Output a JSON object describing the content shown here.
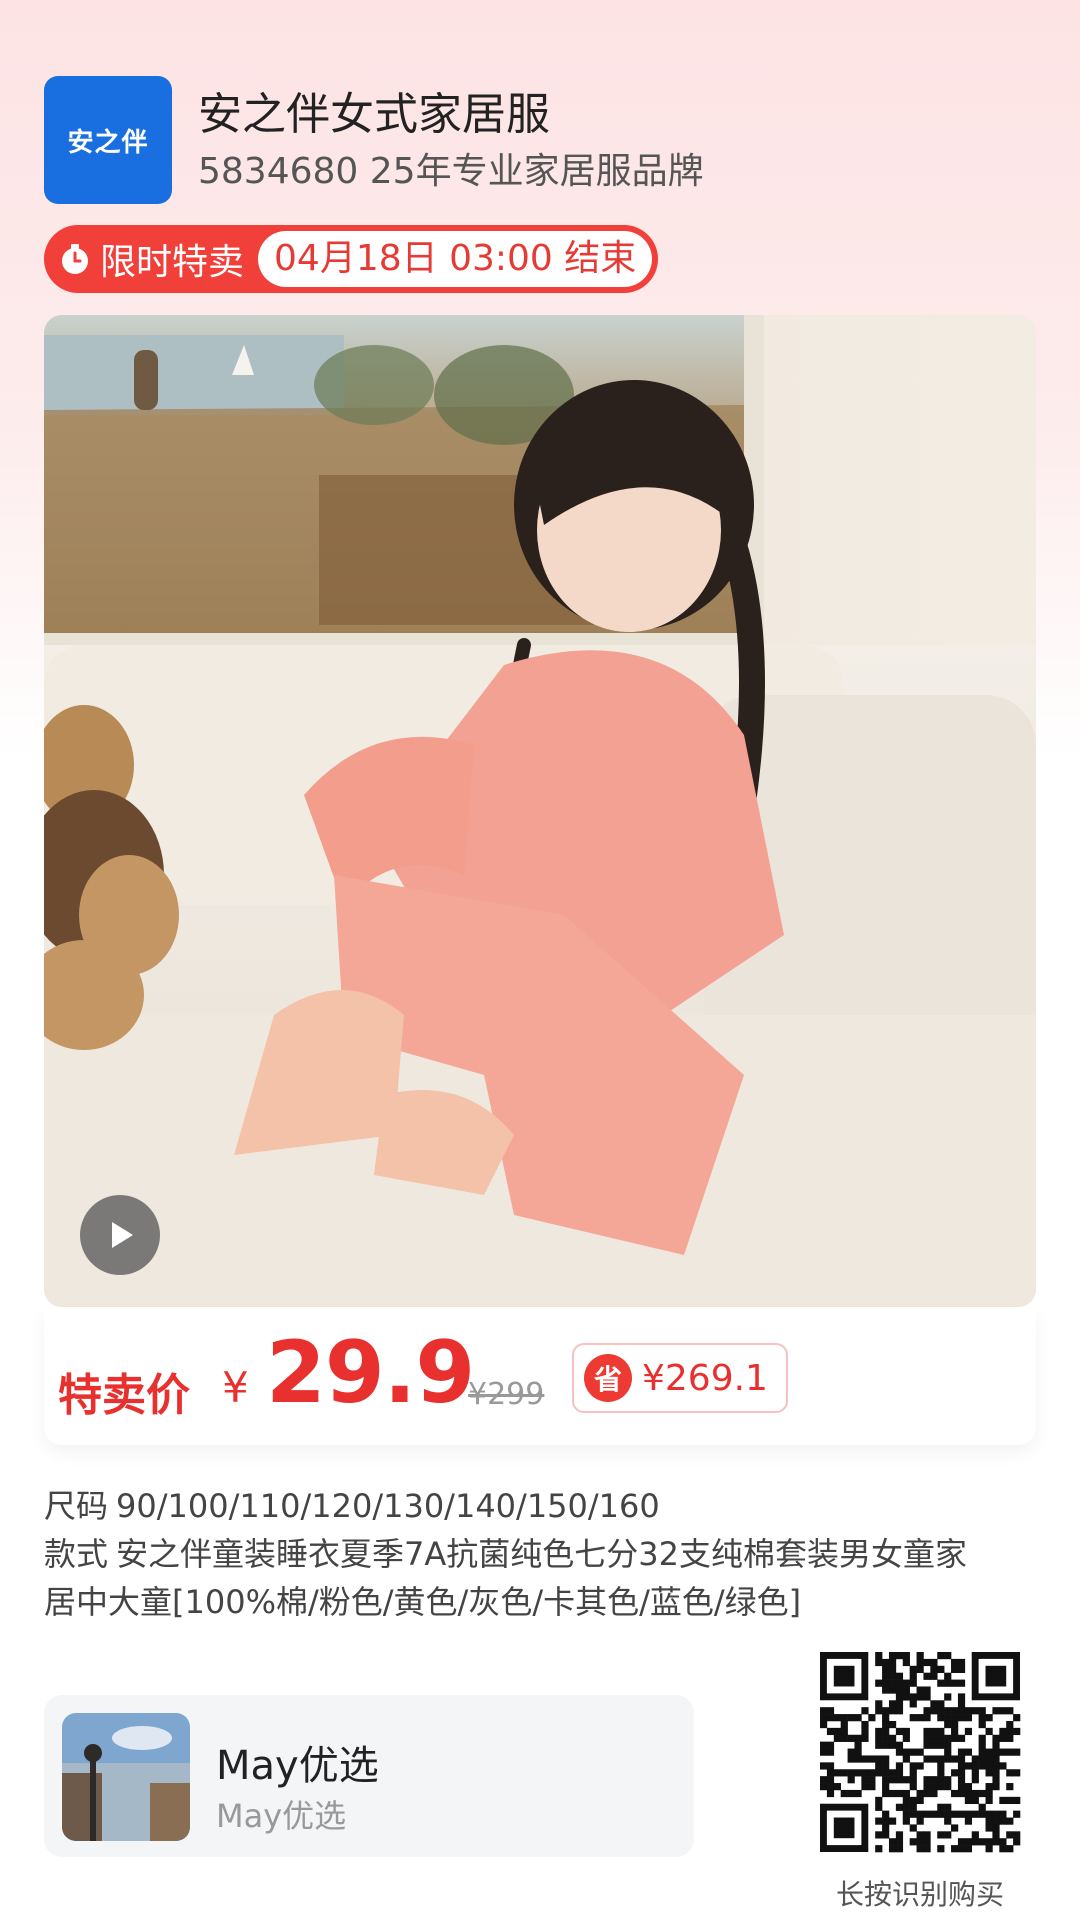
{
  "store": {
    "logo_text": "安之伴",
    "name": "安之伴女式家居服",
    "subtitle": "5834680 25年专业家居服品牌"
  },
  "flash_sale": {
    "label": "限时特卖",
    "end_time": "04月18日 03:00 结束"
  },
  "product": {
    "image_icon": "product-photo",
    "video_icon": "play-icon"
  },
  "price": {
    "label": "特卖价",
    "currency": "¥",
    "value": "29.9",
    "original": "¥299",
    "save_badge": "省",
    "save_amount": "¥269.1"
  },
  "details": {
    "size_label": "尺码",
    "sizes": "90/100/110/120/130/140/150/160",
    "style_label": "款式",
    "style_line1": "安之伴童装睡衣夏季7A抗菌纯色七分32支纯棉套装男女童家",
    "style_line2": "居中大童[100%棉/粉色/黄色/灰色/卡其色/蓝色/绿色]"
  },
  "author": {
    "name": "May优选",
    "subtitle": "May优选"
  },
  "qr": {
    "caption": "长按识别购买"
  },
  "colors": {
    "accent": "#e8302f",
    "logo_blue": "#1a6fe0",
    "flash_red": "#f1403a"
  }
}
